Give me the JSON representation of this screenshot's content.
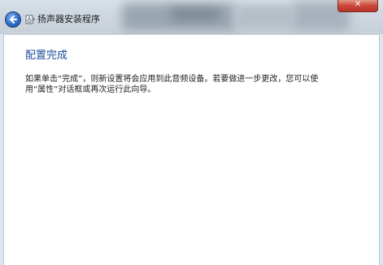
{
  "window": {
    "title": "扬声器安装程序"
  },
  "titlebar": {
    "close_glyph": "✕"
  },
  "icons": {
    "back": "back-arrow-icon",
    "wizard": "speaker-wizard-icon"
  },
  "main": {
    "heading": "配置完成",
    "description": "如果单击“完成”，则新设置将会应用到此音频设备。若要做进一步更改，您可以使用“属性”对话框或再次运行此向导。"
  },
  "colors": {
    "heading": "#1e4e9a",
    "back_button": "#2e6cc7",
    "close_button": "#c9473a"
  }
}
